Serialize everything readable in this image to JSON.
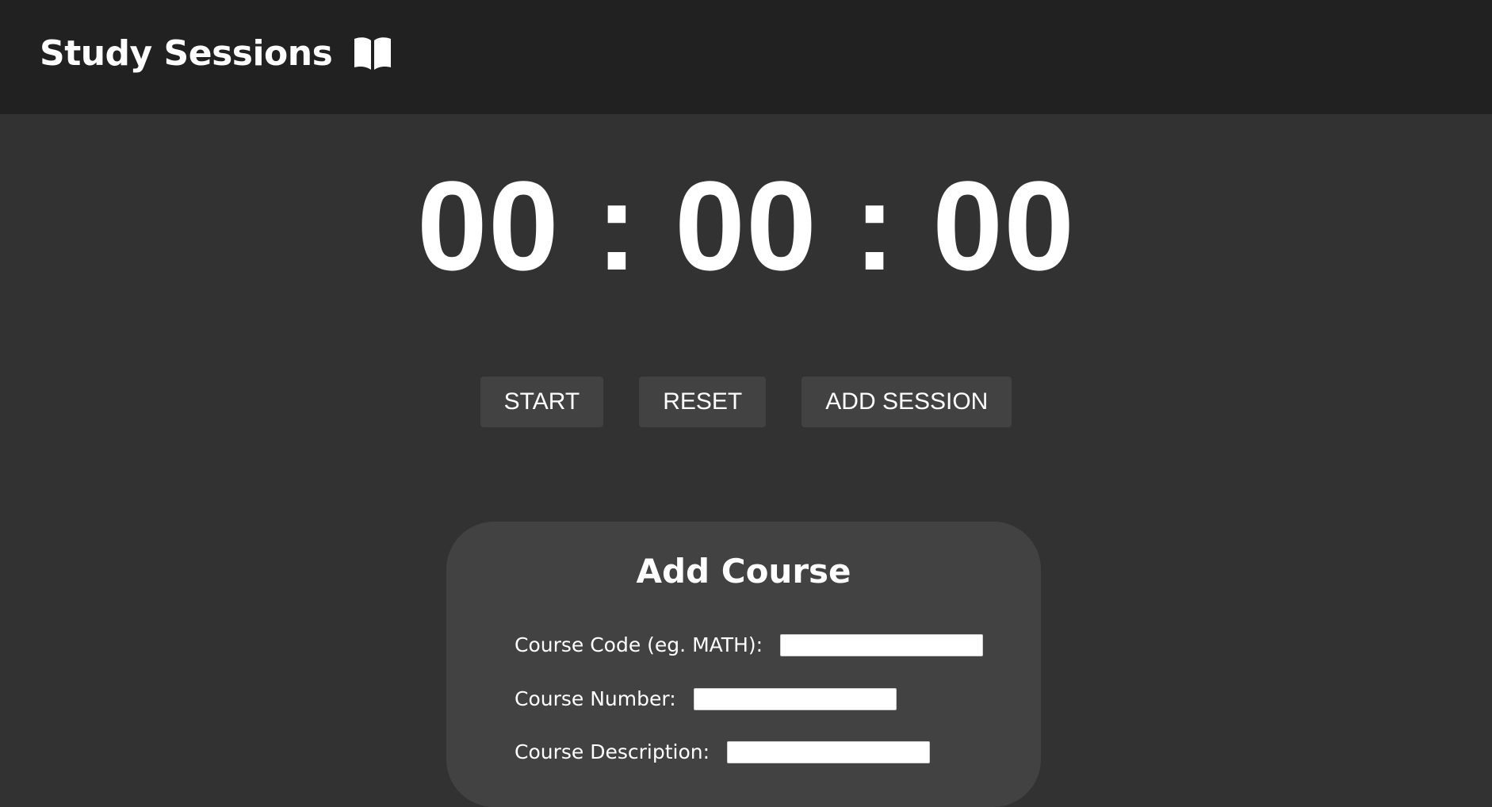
{
  "header": {
    "title": "Study Sessions",
    "icon": "book-open-icon"
  },
  "timer": {
    "display": "00 : 00 : 00"
  },
  "controls": {
    "start_label": "START",
    "reset_label": "RESET",
    "add_session_label": "ADD SESSION"
  },
  "add_course": {
    "title": "Add Course",
    "fields": [
      {
        "label": "Course Code (eg. MATH):",
        "value": ""
      },
      {
        "label": "Course Number:",
        "value": ""
      },
      {
        "label": "Course Description:",
        "value": ""
      }
    ]
  },
  "colors": {
    "background": "#323232",
    "header_background": "#212121",
    "button_background": "#424242",
    "card_background": "#424242",
    "text": "#ffffff"
  }
}
